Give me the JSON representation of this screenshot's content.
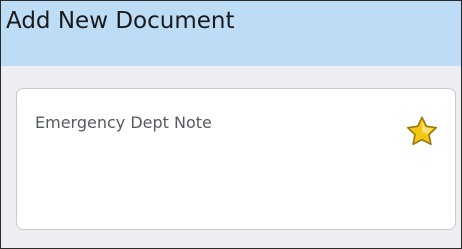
{
  "dialog": {
    "title": "Add New Document"
  },
  "document_card": {
    "label": "Emergency Dept Note",
    "favorite_icon": "star-icon",
    "favorite_color": "#f2c811"
  },
  "colors": {
    "header_background": "#bddcf6",
    "body_background": "#eceef1",
    "card_background": "#ffffff"
  }
}
